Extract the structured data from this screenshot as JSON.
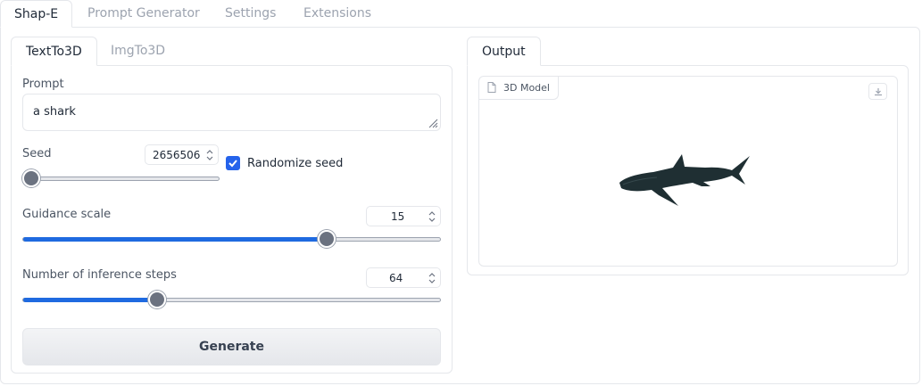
{
  "top_tabs": [
    "Shap-E",
    "Prompt Generator",
    "Settings",
    "Extensions"
  ],
  "sub_tabs": [
    "TextTo3D",
    "ImgTo3D"
  ],
  "prompt": {
    "label": "Prompt",
    "value": "a shark"
  },
  "seed": {
    "label": "Seed",
    "value": "2656506",
    "randomize_label": "Randomize seed",
    "randomize_checked": true,
    "slider_fraction": 0.0
  },
  "guidance": {
    "label": "Guidance scale",
    "value": "15",
    "slider_fraction": 0.73
  },
  "steps": {
    "label": "Number of inference steps",
    "value": "64",
    "slider_fraction": 0.32
  },
  "generate_label": "Generate",
  "output": {
    "tab_label": "Output",
    "model_label": "3D Model"
  },
  "icons": {
    "model": "file-icon",
    "download": "download-icon",
    "checkbox": "check-icon",
    "stepper": "stepper-icon",
    "resize": "resize-grip-icon"
  },
  "colors": {
    "accent": "#2563eb",
    "slider_fill": "#1f6ae0",
    "shark": "#1f2f33"
  }
}
